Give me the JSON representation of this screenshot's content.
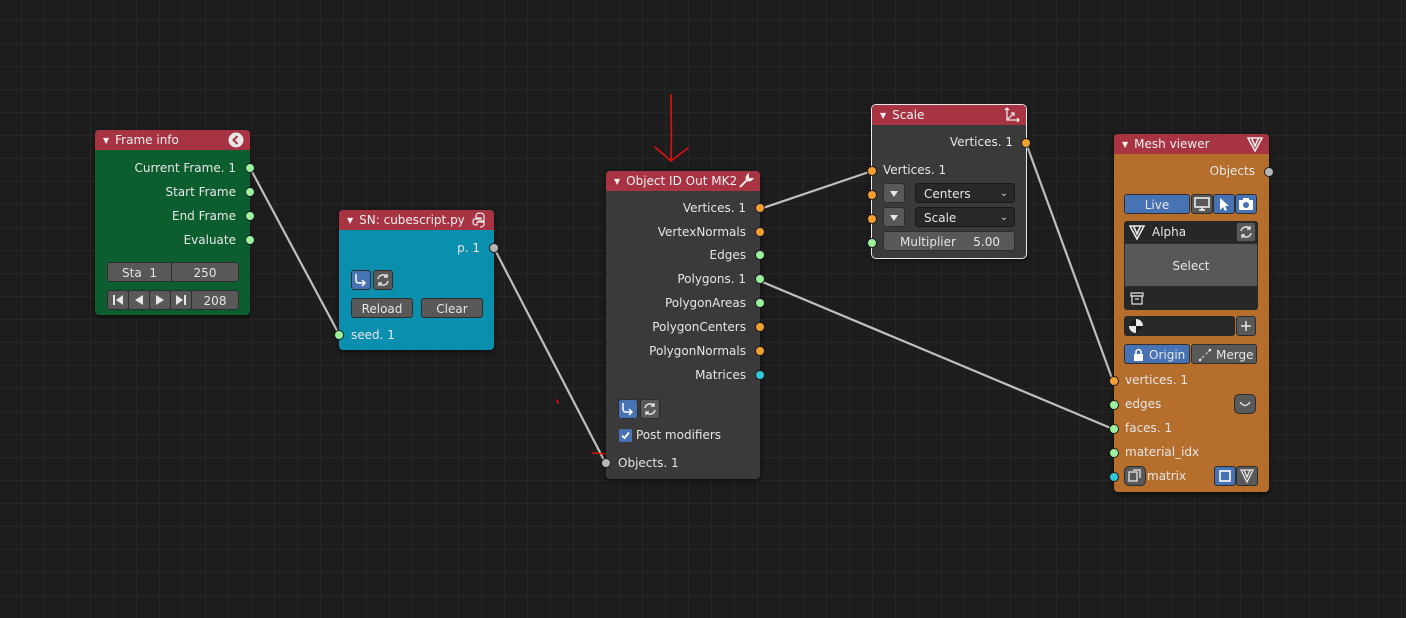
{
  "frame_info": {
    "title": "Frame info",
    "outputs": [
      "Current Frame. 1",
      "Start Frame",
      "End Frame",
      "Evaluate"
    ],
    "start_label": "Sta",
    "start_value": "1",
    "end_value": "250",
    "current_value": "208"
  },
  "cubescript": {
    "title": "SN: cubescript.py",
    "output": "p. 1",
    "reload_label": "Reload",
    "clear_label": "Clear",
    "input": "seed. 1"
  },
  "object_id": {
    "title": "Object ID Out MK2",
    "outputs": [
      "Vertices. 1",
      "VertexNormals",
      "Edges",
      "Polygons. 1",
      "PolygonAreas",
      "PolygonCenters",
      "PolygonNormals",
      "Matrices"
    ],
    "post_modifiers_label": "Post modifiers",
    "post_modifiers_checked": true,
    "input": "Objects. 1"
  },
  "scale": {
    "title": "Scale",
    "output": "Vertices. 1",
    "input_vertices": "Vertices. 1",
    "centers_option": "Centers",
    "scale_option": "Scale",
    "multiplier_label": "Multiplier",
    "multiplier_value": "5.00"
  },
  "mesh_viewer": {
    "title": "Mesh viewer",
    "output": "Objects",
    "live_label": "Live",
    "object_name": "Alpha",
    "select_label": "Select",
    "origin_label": "Origin",
    "merge_label": "Merge",
    "inputs": [
      "vertices. 1",
      "edges",
      "faces. 1",
      "material_idx",
      "matrix"
    ]
  },
  "colors": {
    "header_red": "#a83342",
    "frame_info_body": "#0d5e2f",
    "cubescript_body": "#0b8fae",
    "object_id_body": "#3a3a3a",
    "scale_body": "#3a3a3a",
    "mesh_viewer_body": "#b56e2c",
    "annotation_red": "#e01010"
  }
}
